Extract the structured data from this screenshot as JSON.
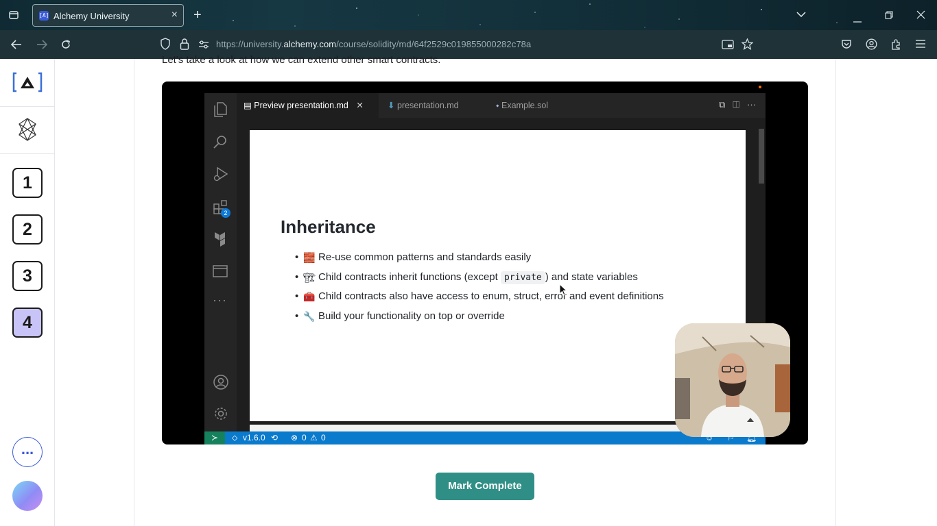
{
  "browser": {
    "tab_title": "Alchemy University",
    "tab_favicon_text": "[A]",
    "url_prefix": "https://university.",
    "url_domain": "alchemy.com",
    "url_path": "/course/solidity/md/64f2529c019855000282c78a"
  },
  "rail": {
    "steps": [
      "1",
      "2",
      "3",
      "4"
    ],
    "active_step": "4",
    "more_label": "..."
  },
  "content": {
    "intro_text": "Let's take a look at how we can extend other smart contracts."
  },
  "video": {
    "editor": {
      "tabs": [
        {
          "label": "Preview presentation.md",
          "active": true
        },
        {
          "label": "presentation.md",
          "active": false
        },
        {
          "label": "Example.sol",
          "active": false
        }
      ],
      "extensions_badge": "2",
      "status": {
        "version": "v1.6.0",
        "errors": "0",
        "warnings": "0"
      }
    },
    "slide": {
      "title": "Inheritance",
      "bullets": [
        {
          "emoji": "🧱",
          "text": "Re-use common patterns and standards easily"
        },
        {
          "emoji": "🏗",
          "text_before": "Child contracts inherit functions (except ",
          "code": "private",
          "text_after": ") and state variables"
        },
        {
          "emoji": "🧰",
          "text": "Child contracts also have access to enum, struct, error and event definitions"
        },
        {
          "emoji": "🔧",
          "text": "Build your functionality on top or override"
        }
      ]
    }
  },
  "actions": {
    "mark_complete": "Mark Complete"
  },
  "colors": {
    "active_step_bg": "#c9c4f7",
    "mark_complete_bg": "#2f8f86",
    "vscode_statusbar": "#0a7acc"
  }
}
